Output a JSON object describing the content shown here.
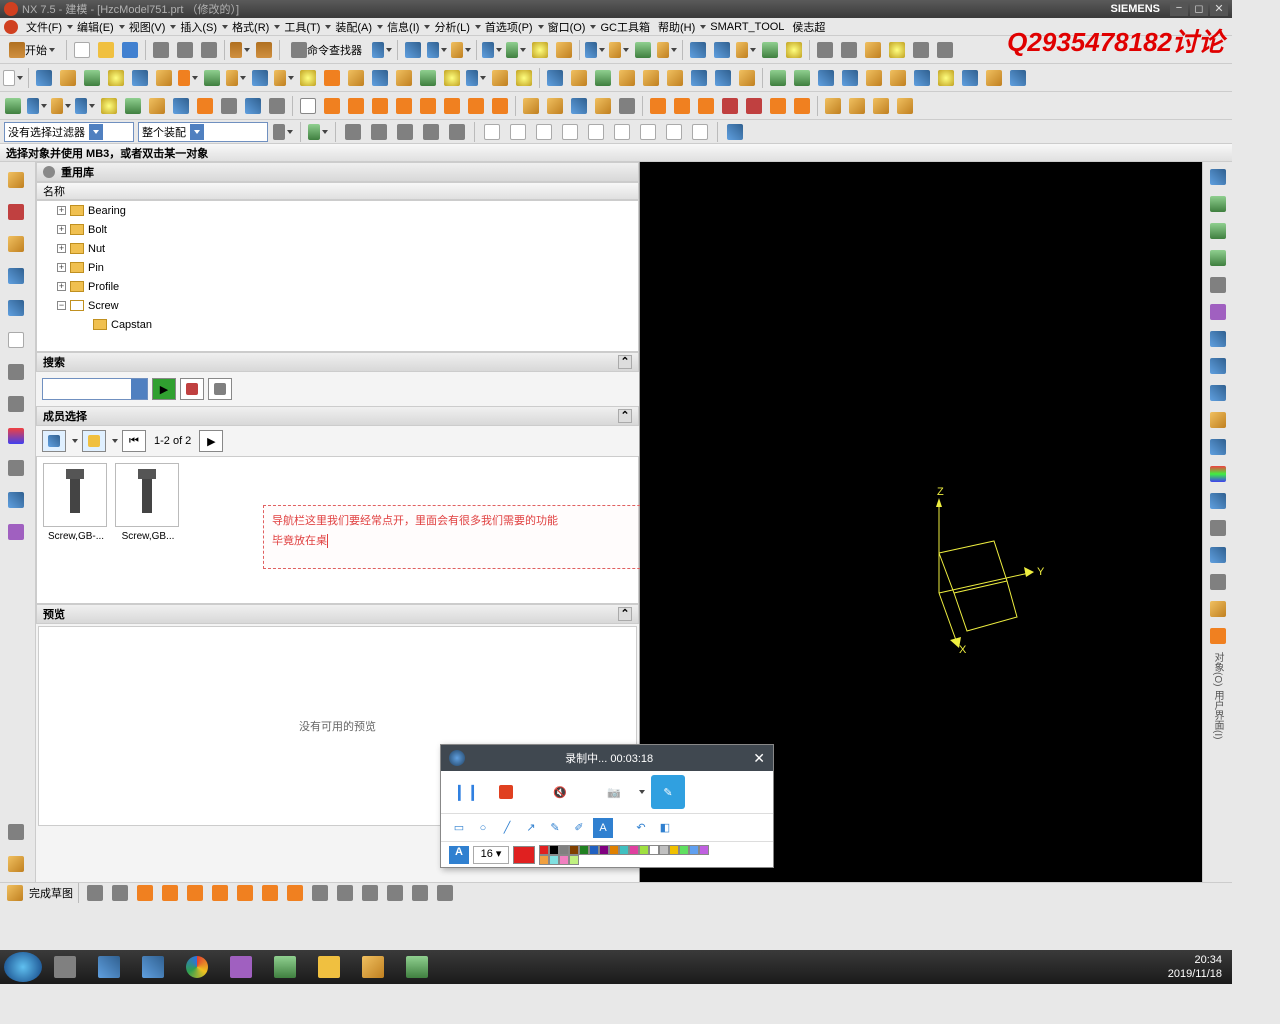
{
  "title": "NX 7.5 - 建模 - [HzcModel751.prt （修改的）]",
  "brand": "SIEMENS",
  "watermark": "Q2935478182讨论",
  "menu": [
    "文件(F)",
    "编辑(E)",
    "视图(V)",
    "插入(S)",
    "格式(R)",
    "工具(T)",
    "装配(A)",
    "信息(I)",
    "分析(L)",
    "首选项(P)",
    "窗口(O)",
    "GC工具箱",
    "帮助(H)",
    "SMART_TOOL",
    "侯志超"
  ],
  "start_label": "开始",
  "cmd_finder": "命令查找器",
  "filter1": "没有选择过滤器",
  "filter2": "整个装配",
  "status": "选择对象并使用 MB3，或者双击某一对象",
  "panel": {
    "reuse": "重用库",
    "name_col": "名称",
    "nodes": [
      {
        "label": "Bearing",
        "exp": "+"
      },
      {
        "label": "Bolt",
        "exp": "+"
      },
      {
        "label": "Nut",
        "exp": "+"
      },
      {
        "label": "Pin",
        "exp": "+"
      },
      {
        "label": "Profile",
        "exp": "+"
      },
      {
        "label": "Screw",
        "exp": "−",
        "open": true
      },
      {
        "label": "Capstan",
        "child": true
      }
    ],
    "search": "搜索",
    "member": "成员选择",
    "pager": "1-2 of 2",
    "thumbs": [
      {
        "label": "Screw,GB-..."
      },
      {
        "label": "Screw,GB..."
      }
    ],
    "preview": "预览",
    "no_preview": "没有可用的预览"
  },
  "annotation_line1": "导航栏这里我们要经常点开，里面会有很多我们需要的功能",
  "annotation_line2": "毕竟放在桌",
  "axes": {
    "x": "X",
    "y": "Y",
    "z": "Z"
  },
  "recorder": {
    "title": "录制中... 00:03:18",
    "fontsize": "16"
  },
  "bottom_label": "完成草图",
  "right_labels": [
    "对象(O)",
    "用户界面(I)"
  ],
  "clock": {
    "time": "20:34",
    "date": "2019/11/18"
  },
  "palette": [
    "#e02020",
    "#000",
    "#808080",
    "#804000",
    "#208020",
    "#2060c0",
    "#800080",
    "#e08000",
    "#40c0c0",
    "#e040a0",
    "#a0e040",
    "#fff",
    "#c0c0c0",
    "#f0c000",
    "#60e060",
    "#60a0f0",
    "#c060e0",
    "#f0a040",
    "#80e0e0",
    "#f080c0",
    "#c0f080"
  ]
}
